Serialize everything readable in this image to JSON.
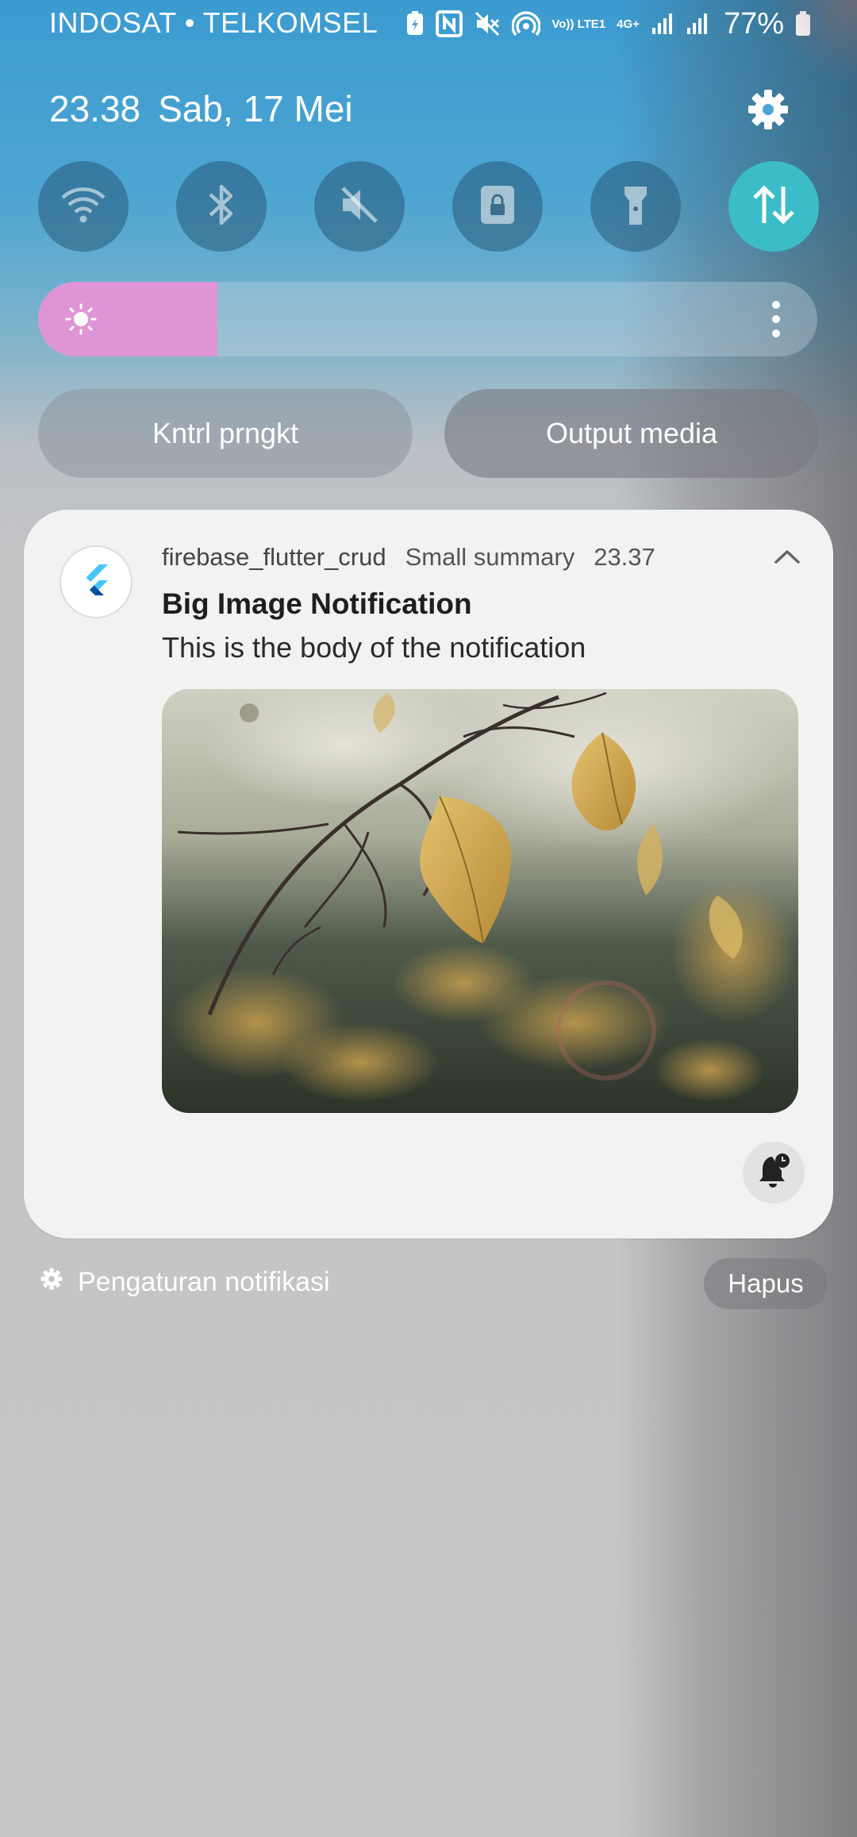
{
  "status_bar": {
    "carrier": "INDOSAT • TELKOMSEL",
    "network_top": "Vo)) LTE1",
    "network_type": "4G+",
    "battery": "77%",
    "icons": [
      "battery-saver-icon",
      "nfc-icon",
      "mute-icon",
      "hotspot-icon",
      "volte-icon",
      "signal-icon",
      "signal-icon",
      "battery-icon"
    ]
  },
  "panel": {
    "time": "23.38",
    "date": "Sab, 17 Mei",
    "toggles": [
      {
        "name": "wifi",
        "icon": "wifi-icon",
        "active": false
      },
      {
        "name": "bluetooth",
        "icon": "bluetooth-icon",
        "active": false
      },
      {
        "name": "sound",
        "icon": "mute-icon",
        "active": false
      },
      {
        "name": "rotation-lock",
        "icon": "lock-icon",
        "active": false
      },
      {
        "name": "flashlight",
        "icon": "flashlight-icon",
        "active": false
      },
      {
        "name": "mobile-data",
        "icon": "data-transfer-icon",
        "active": true
      }
    ],
    "brightness_level": 0.23,
    "device_control_label": "Kntrl prngkt",
    "media_output_label": "Output media"
  },
  "notification": {
    "app_name": "firebase_flutter_crud",
    "summary": "Small summary",
    "time": "23.37",
    "title": "Big Image Notification",
    "body": "This is the body of the notification",
    "app_icon": "flutter-logo-icon",
    "image_description": "autumn leaves photo"
  },
  "footer": {
    "settings_label": "Pengaturan notifikasi",
    "clear_label": "Hapus"
  },
  "colors": {
    "accent_active": "#3cbcc9",
    "brightness_fill": "#df95d5",
    "card_bg": "#f2f2f2"
  }
}
